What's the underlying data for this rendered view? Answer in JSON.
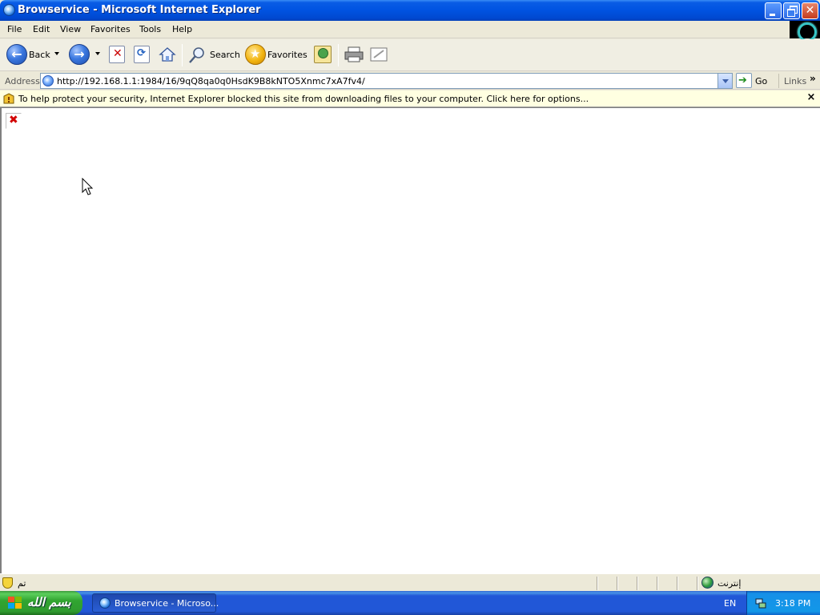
{
  "window": {
    "title": "Browservice - Microsoft Internet Explorer"
  },
  "menu": [
    "File",
    "Edit",
    "View",
    "Favorites",
    "Tools",
    "Help"
  ],
  "toolbar": {
    "back_label": "Back",
    "search_label": "Search",
    "favorites_label": "Favorites"
  },
  "address": {
    "label": "Address",
    "url": "http://192.168.1.1:1984/16/9qQ8qa0q0HsdK9B8kNTO5Xnmc7xA7fv4/",
    "go_label": "Go",
    "links_label": "Links",
    "links_chevron": "»"
  },
  "infobar": {
    "text": "To help protect your security, Internet Explorer blocked this site from downloading files to your computer. Click here for options...",
    "close": "×"
  },
  "status": {
    "text": "تم",
    "zone": "إنترنت"
  },
  "taskbar": {
    "start_label": "بسم الله",
    "task_label": "Browservice - Microso...",
    "language": "EN",
    "clock": "3:18 PM"
  }
}
